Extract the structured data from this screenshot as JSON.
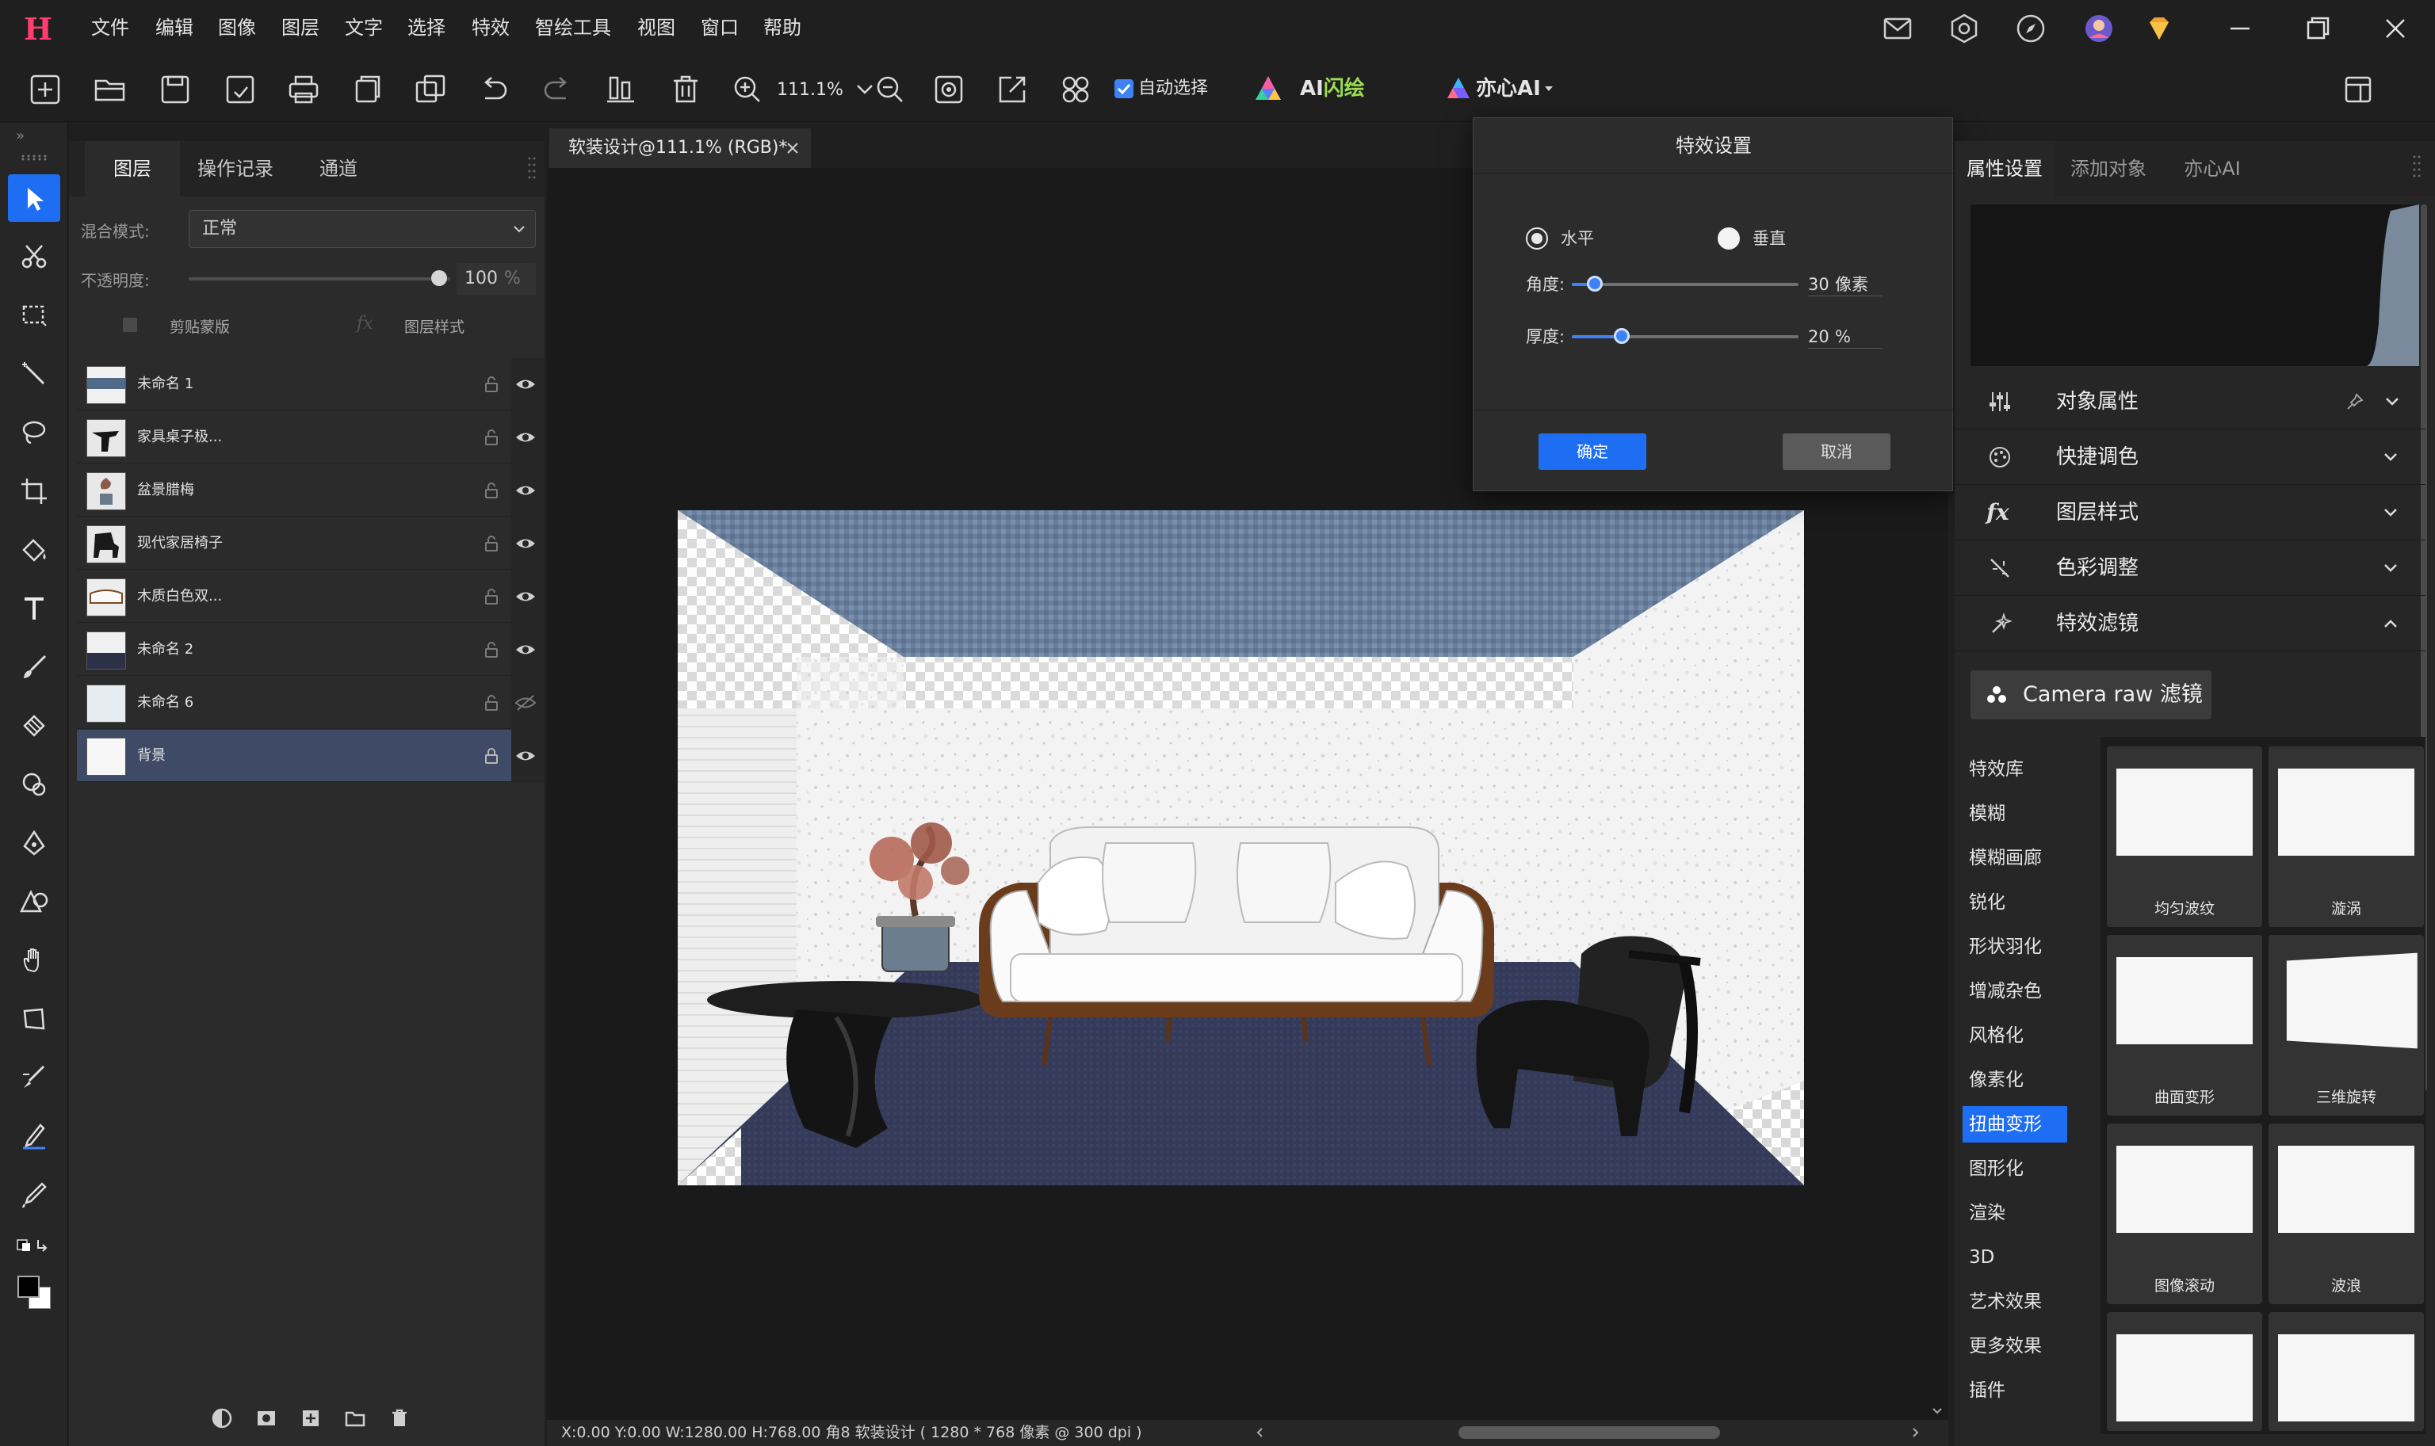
{
  "menubar": {
    "logo": "H",
    "items": [
      "文件",
      "编辑",
      "图像",
      "图层",
      "文字",
      "选择",
      "特效",
      "智绘工具",
      "视图",
      "窗口",
      "帮助"
    ]
  },
  "toolbar": {
    "zoom": "111.1%",
    "auto_select": "自动选择",
    "ai_flash_prefix": "AI",
    "ai_flash_suffix": "闪绘",
    "yixin_ai": "亦心AI"
  },
  "left_panel": {
    "tabs": [
      "图层",
      "操作记录",
      "通道"
    ],
    "blend_mode_label": "混合模式:",
    "blend_mode_value": "正常",
    "opacity_label": "不透明度:",
    "opacity_value": "100",
    "opacity_unit": "%",
    "opacity_fraction": 1.0,
    "clip_mask_label": "剪贴蒙版",
    "layer_style_label": "图层样式",
    "layers": [
      {
        "name": "未命名 1",
        "visible": true
      },
      {
        "name": "家具桌子极...",
        "visible": true
      },
      {
        "name": "盆景腊梅",
        "visible": true
      },
      {
        "name": "现代家居椅子",
        "visible": true
      },
      {
        "name": "木质白色双...",
        "visible": true
      },
      {
        "name": "未命名 2",
        "visible": true
      },
      {
        "name": "未命名 6",
        "visible": false
      },
      {
        "name": "背景",
        "visible": true,
        "selected": true
      }
    ]
  },
  "document": {
    "tab_title": "软装设计@111.1% (RGB)*",
    "status": "X:0.00 Y:0.00 W:1280.00 H:768.00 角8    软装设计 ( 1280 * 768 像素 @ 300 dpi )"
  },
  "fx_dialog": {
    "title": "特效设置",
    "option_horizontal": "水平",
    "option_vertical": "垂直",
    "selected": "horizontal",
    "angle_label": "角度:",
    "angle_value": "30",
    "angle_unit": "像素",
    "thickness_label": "厚度:",
    "thickness_value": "20",
    "thickness_unit": "%",
    "angle_fraction": 0.1,
    "thickness_fraction": 0.22,
    "ok": "确定",
    "cancel": "取消"
  },
  "right_panel": {
    "tabs": [
      "属性设置",
      "添加对象",
      "亦心AI"
    ],
    "sections": [
      {
        "label": "对象属性",
        "icon": "sliders-icon",
        "expanded": false
      },
      {
        "label": "快捷调色",
        "icon": "palette-icon",
        "expanded": false
      },
      {
        "label": "图层样式",
        "icon": "fx-icon",
        "expanded": false
      },
      {
        "label": "色彩调整",
        "icon": "color-adjust-icon",
        "expanded": false
      },
      {
        "label": "特效滤镜",
        "icon": "filter-icon",
        "expanded": true
      }
    ],
    "camera_raw": "Camera raw 滤镜",
    "fx_categories": [
      "特效库",
      "模糊",
      "模糊画廊",
      "锐化",
      "形状羽化",
      "增减杂色",
      "风格化",
      "像素化",
      "扭曲变形",
      "图形化",
      "渲染",
      "3D",
      "艺术效果",
      "更多效果",
      "插件"
    ],
    "fx_active_category": "扭曲变形",
    "fx_items": [
      "均匀波纹",
      "漩涡",
      "曲面变形",
      "三维旋转",
      "图像滚动",
      "波浪",
      "",
      ""
    ]
  },
  "colors": {
    "accent": "#1e6ef4",
    "logo": "#ff3d6e",
    "ai_green": "#9bdd52"
  }
}
